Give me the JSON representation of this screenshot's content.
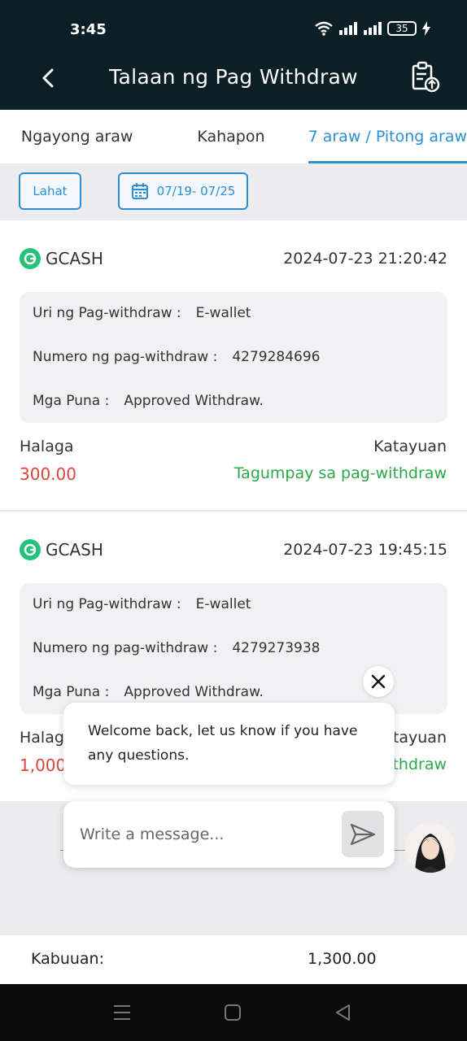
{
  "status_bar": {
    "time": "3:45",
    "battery": "35"
  },
  "header": {
    "title": "Talaan ng Pag Withdraw",
    "back_icon": "chevron-left-icon",
    "action_icon": "clipboard-upload-icon"
  },
  "tabs": [
    {
      "label": "Ngayong araw"
    },
    {
      "label": "Kahapon"
    },
    {
      "label": "7 araw / Pitong araw"
    }
  ],
  "active_tab": 2,
  "filters": {
    "all_label": "Lahat",
    "date_range": "07/19- 07/25"
  },
  "labels": {
    "type": "Uri ng Pag-withdraw :",
    "number": "Numero ng pag-withdraw :",
    "remarks": "Mga Puna :",
    "amount": "Halaga",
    "status": "Katayuan"
  },
  "records": [
    {
      "channel": "GCASH",
      "datetime": "2024-07-23 21:20:42",
      "type": "E-wallet",
      "number": "4279284696",
      "remarks": "Approved Withdraw.",
      "amount": "300.00",
      "status": "Tagumpay sa pag-withdraw"
    },
    {
      "channel": "GCASH",
      "datetime": "2024-07-23 19:45:15",
      "type": "E-wallet",
      "number": "4279273938",
      "remarks": "Approved Withdraw.",
      "amount": "1,000",
      "status": "ithdraw"
    }
  ],
  "chat": {
    "message": "Welcome back, let us know if you have any questions.",
    "input_placeholder": "Write a message...",
    "second_status_label": "atayuan",
    "second_amount_label": "Halaga"
  },
  "footer": {
    "total_label": "Kabuuan:",
    "total_value": "1,300.00"
  },
  "colors": {
    "accent": "#2b8fd6",
    "success": "#2aa84a",
    "amount": "#d9453b",
    "header_bg": "#0b1f26"
  }
}
